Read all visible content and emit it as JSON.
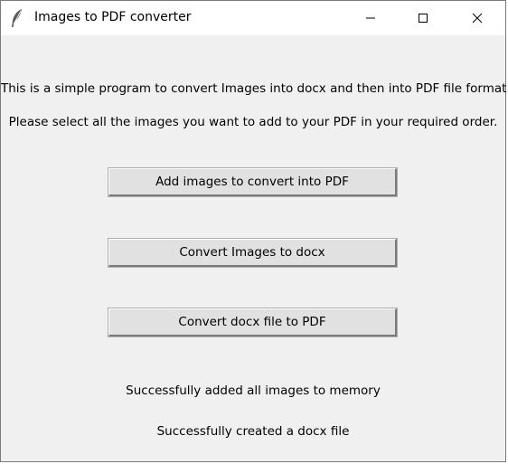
{
  "window": {
    "title": "Images to PDF converter"
  },
  "icons": {
    "app": "feather-icon",
    "minimize": "minimize-icon",
    "maximize": "maximize-icon",
    "close": "close-icon"
  },
  "main": {
    "intro_text": "This is a simple program to convert Images into docx and then into PDF file format.",
    "instruction_text": "Please select all the images you want to add to your PDF in your required order.",
    "buttons": {
      "add_images": "Add images to convert into PDF",
      "convert_docx": "Convert Images to docx",
      "convert_pdf": "Convert docx file to PDF"
    },
    "status": {
      "images_added": "Successfully added all images to memory",
      "docx_created": "Successfully created a docx file"
    }
  }
}
